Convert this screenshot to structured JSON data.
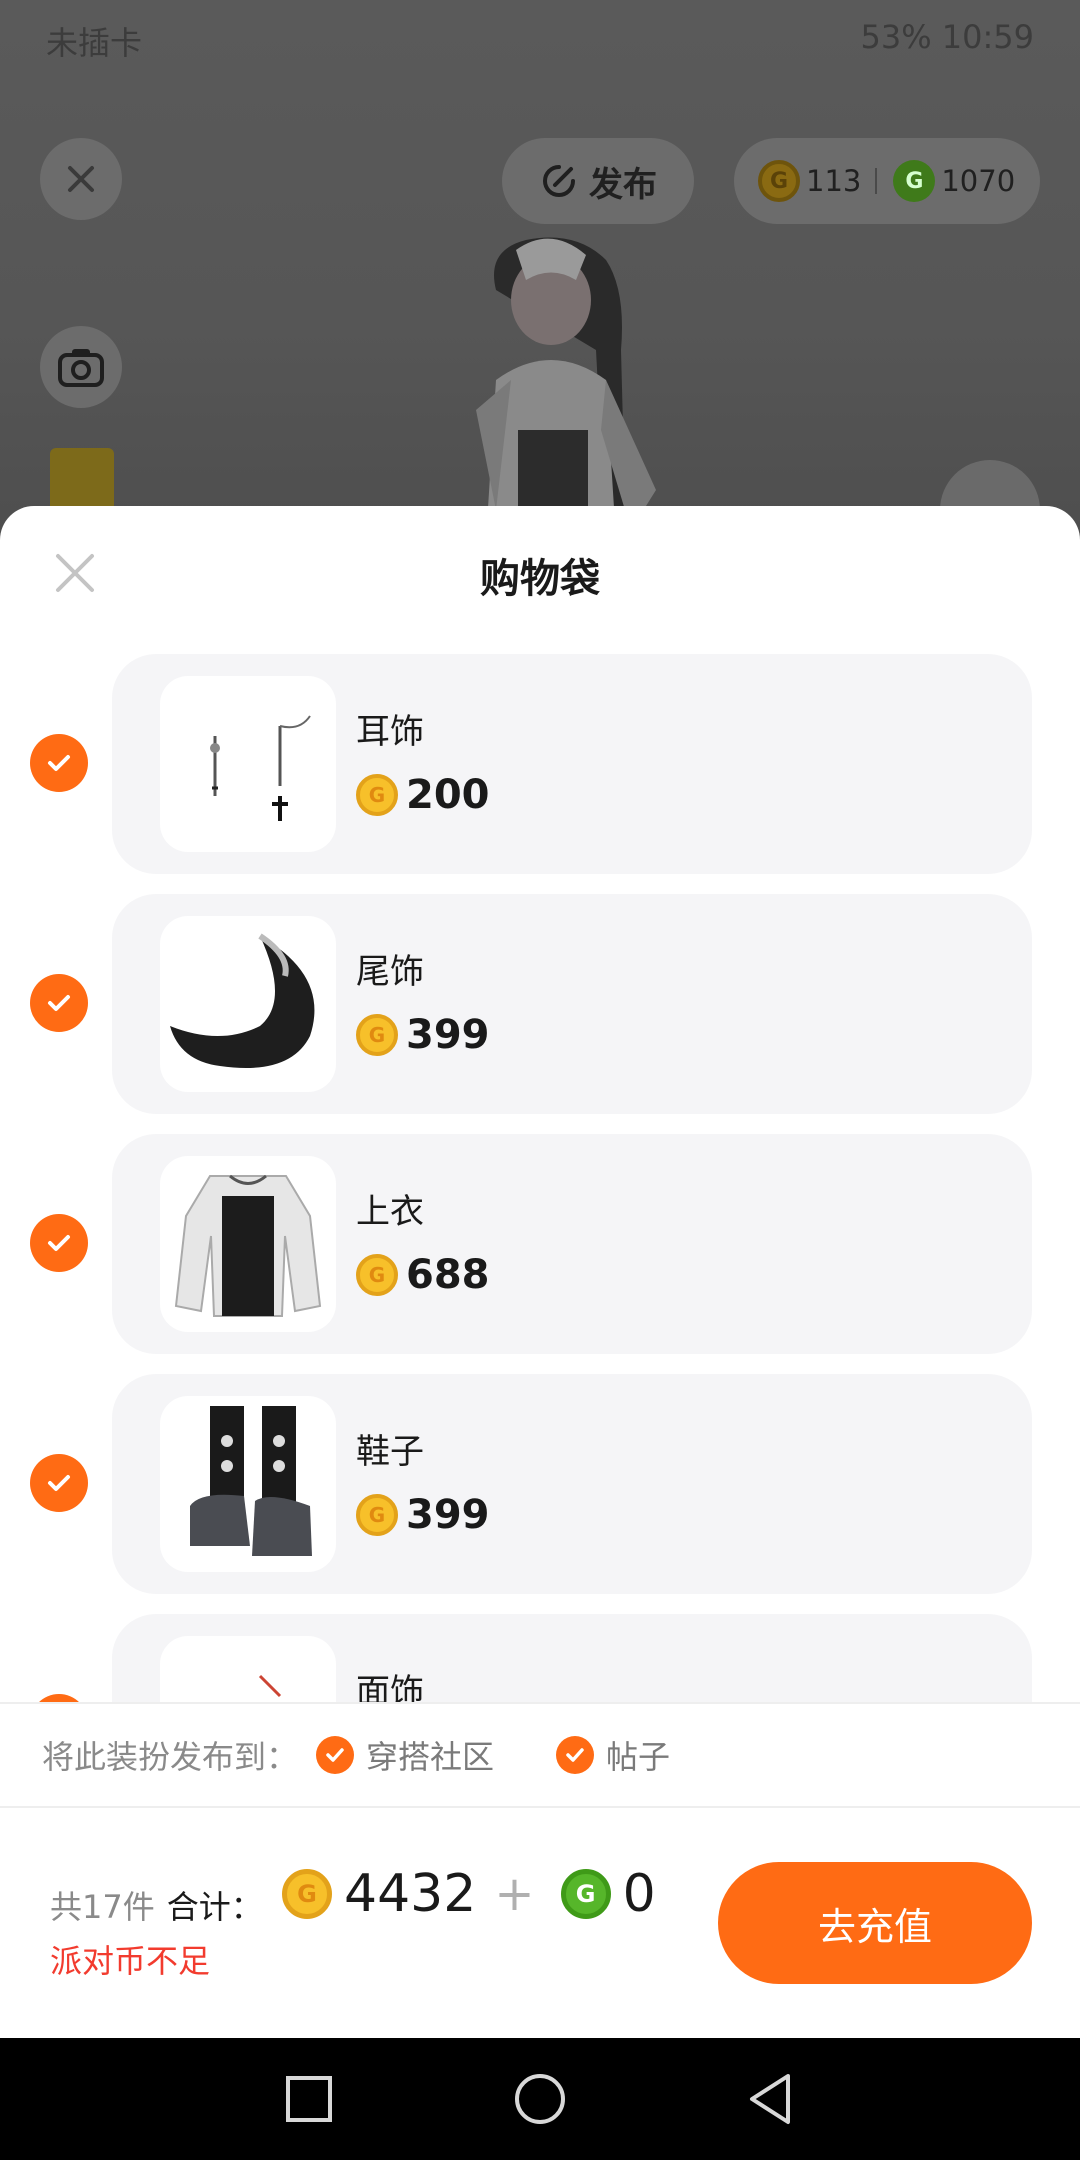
{
  "status_bar": {
    "carrier": "未插卡",
    "right": "53% 10:59"
  },
  "top_bar": {
    "publish_label": "发布",
    "coins": [
      {
        "icon": "gold-coin-icon",
        "value": "113"
      },
      {
        "icon": "green-coin-icon",
        "value": "1070"
      }
    ]
  },
  "sheet": {
    "title": "购物袋",
    "items": [
      {
        "name": "耳饰",
        "price": "200",
        "checked": true,
        "thumb": "earring-thumbnail"
      },
      {
        "name": "尾饰",
        "price": "399",
        "checked": true,
        "thumb": "tail-thumbnail"
      },
      {
        "name": "上衣",
        "price": "688",
        "checked": true,
        "thumb": "top-thumbnail"
      },
      {
        "name": "鞋子",
        "price": "399",
        "checked": true,
        "thumb": "shoes-thumbnail"
      },
      {
        "name": "面饰",
        "price": "",
        "checked": true,
        "thumb": "face-accessory-thumbnail"
      }
    ],
    "publish_prefix": "将此装扮发布到：",
    "publish_options": [
      "穿搭社区",
      "帖子"
    ]
  },
  "summary": {
    "count": "共17件",
    "total_label": "合计：",
    "gold_total": "4432",
    "plus": "+",
    "green_total": "0",
    "warning": "派对币不足",
    "recharge_label": "去充值"
  },
  "colors": {
    "accent": "#ff6b14",
    "warning": "#f23b2e",
    "gold_coin": "#f7c02a",
    "green_coin": "#56b62a"
  }
}
